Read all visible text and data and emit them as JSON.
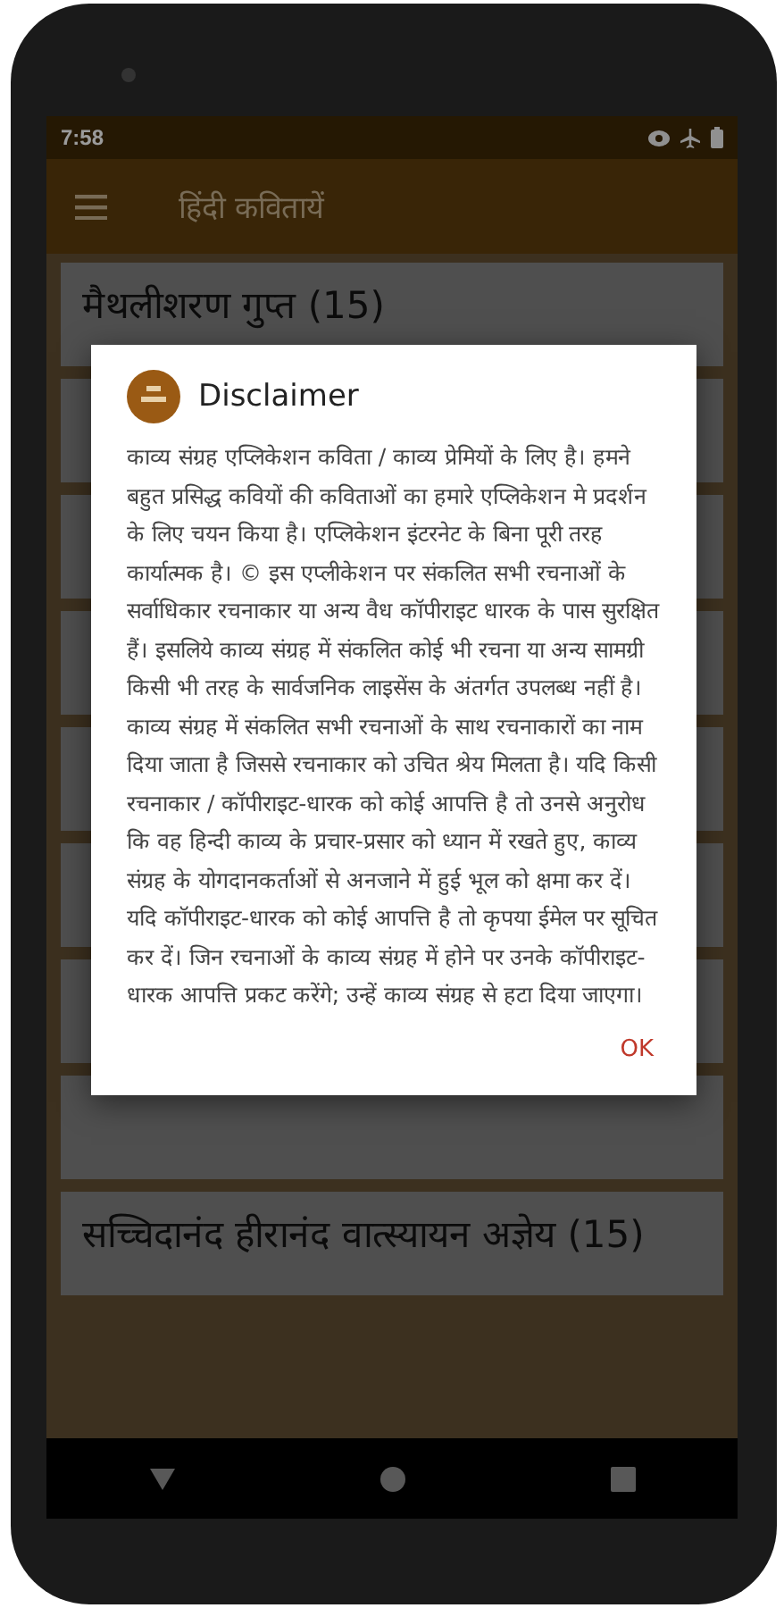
{
  "status_bar": {
    "time": "7:58"
  },
  "app_bar": {
    "title": "हिंदी कवितायें"
  },
  "poets": [
    {
      "name": "मैथलीशरण गुप्त (15)"
    },
    {
      "name": "सच्चिदानंद हीरानंद वात्स्यायन अज्ञेय (15)"
    }
  ],
  "dialog": {
    "title": "Disclaimer",
    "body": "काव्य संग्रह एप्लिकेशन कविता / काव्य प्रेमियों के लिए है। हमने बहुत प्रसिद्ध कवियों की कविताओं का हमारे एप्लिकेशन मे प्रदर्शन के लिए चयन किया है। एप्लिकेशन इंटरनेट के बिना पूरी तरह कार्यात्मक है। © इस एप्लीकेशन पर संकलित सभी रचनाओं के सर्वाधिकार रचनाकार या अन्य वैध कॉपीराइट धारक के पास सुरक्षित हैं। इसलिये काव्य संग्रह में संकलित कोई भी रचना या अन्य सामग्री किसी भी तरह के सार्वजनिक लाइसेंस के अंतर्गत उपलब्ध नहीं है। काव्य संग्रह में संकलित सभी रचनाओं के साथ रचनाकारों का नाम दिया जाता है जिससे रचनाकार को उचित श्रेय मिलता है। यदि किसी रचनाकार / कॉपीराइट-धारक को कोई आपत्ति है तो उनसे अनुरोध कि वह हिन्दी काव्य के प्रचार-प्रसार को ध्यान में रखते हुए, काव्य संग्रह के योगदानकर्ताओं से अनजाने में हुई भूल को क्षमा कर दें। यदि कॉपीराइट-धारक को कोई आपत्ति है तो कृपया ईमेल पर सूचित कर दें। जिन रचनाओं के काव्य संग्रह में होने पर उनके कॉपीराइट-धारक आपत्ति प्रकट करेंगे; उन्हें काव्य संग्रह से हटा दिया जाएगा।",
    "button": "OK"
  }
}
